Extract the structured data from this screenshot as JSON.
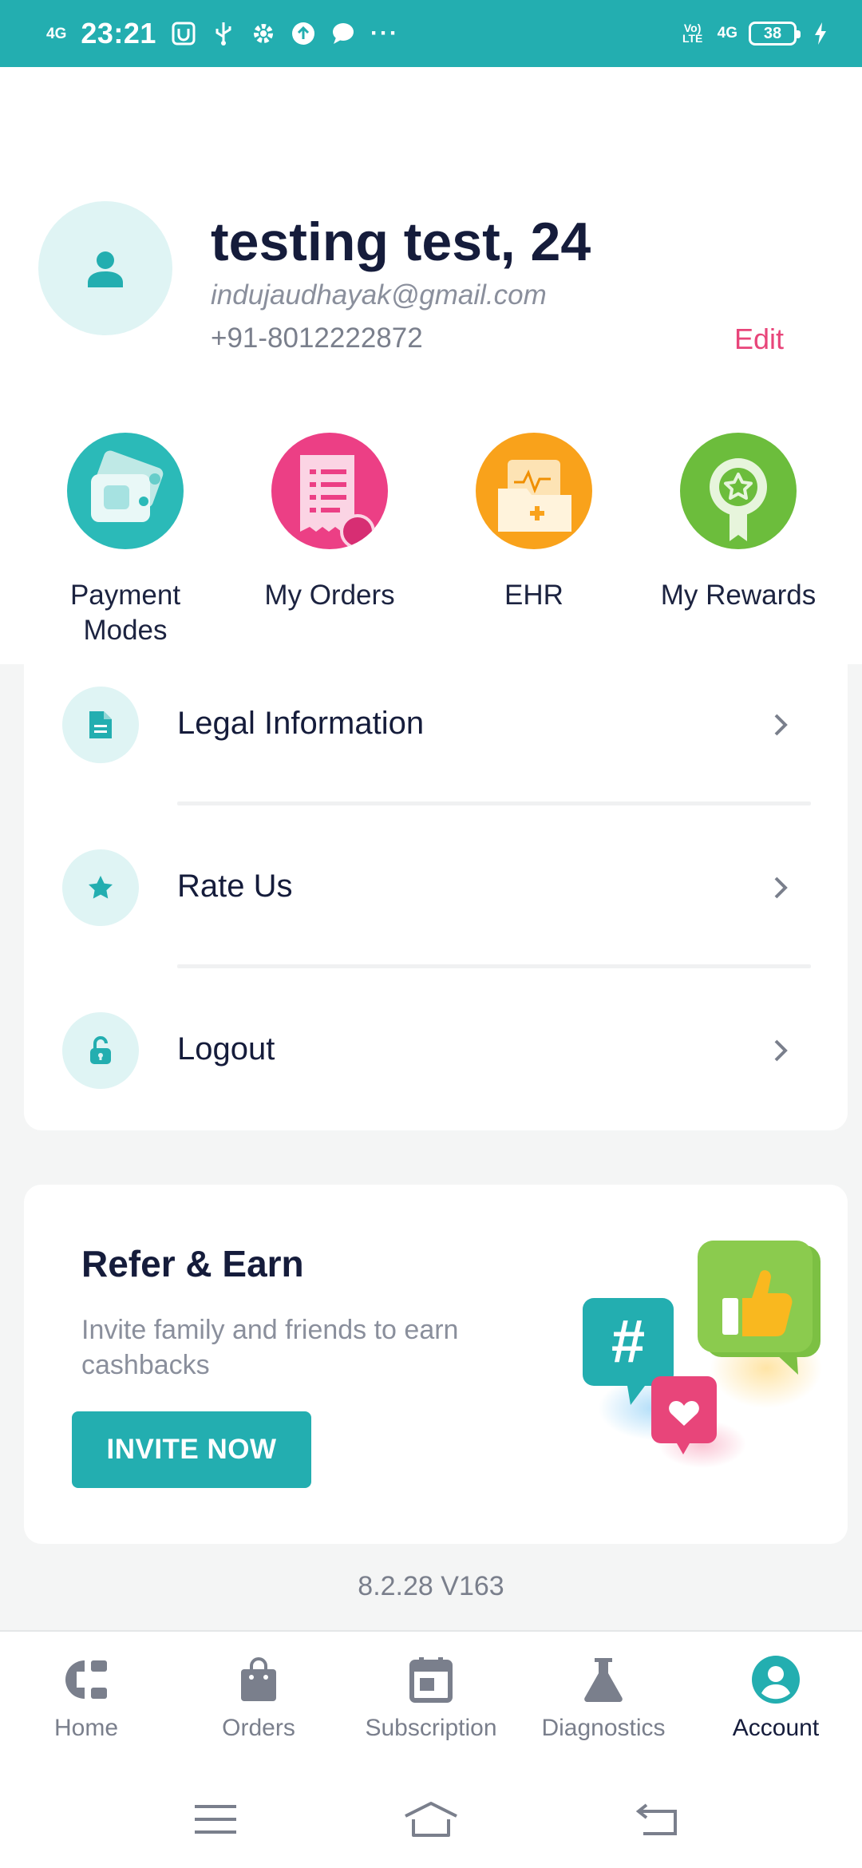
{
  "status_bar": {
    "network": "4G",
    "time": "23:21",
    "volte": "Vo) LTE",
    "network_right": "4G",
    "battery": "38",
    "overflow": "···"
  },
  "profile": {
    "name": "testing test, 24",
    "email": "indujaudhayak@gmail.com",
    "phone": "+91-8012222872",
    "edit_label": "Edit"
  },
  "quick_actions": [
    {
      "label": "Payment Modes",
      "icon": "wallet-card-icon",
      "color": "#2bbab8"
    },
    {
      "label": "My Orders",
      "icon": "receipt-icon",
      "color": "#ec3f85"
    },
    {
      "label": "EHR",
      "icon": "health-record-folder-icon",
      "color": "#f9a21b"
    },
    {
      "label": "My Rewards",
      "icon": "reward-badge-icon",
      "color": "#6cbd3c"
    }
  ],
  "menu": [
    {
      "label": "Legal Information",
      "icon": "document-icon"
    },
    {
      "label": "Rate Us",
      "icon": "star-icon"
    },
    {
      "label": "Logout",
      "icon": "unlock-icon"
    }
  ],
  "refer": {
    "title": "Refer & Earn",
    "subtitle": "Invite family and friends to earn cashbacks",
    "button": "INVITE NOW"
  },
  "version": "8.2.28 V163",
  "bottom_nav": [
    {
      "label": "Home",
      "icon": "home-logo-icon",
      "active": false
    },
    {
      "label": "Orders",
      "icon": "shopping-bag-icon",
      "active": false
    },
    {
      "label": "Subscription",
      "icon": "calendar-icon",
      "active": false
    },
    {
      "label": "Diagnostics",
      "icon": "flask-icon",
      "active": false
    },
    {
      "label": "Account",
      "icon": "account-icon",
      "active": true
    }
  ],
  "colors": {
    "accent": "#23aeb0",
    "edit": "#e8457a",
    "text_dark": "#151c3b",
    "text_muted": "#8a8f9c"
  }
}
